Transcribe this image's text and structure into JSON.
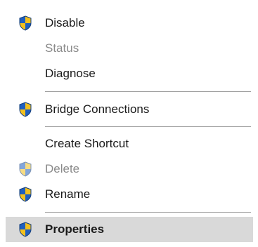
{
  "context_menu": {
    "items": [
      {
        "label": "Disable",
        "icon": "uac-shield-icon",
        "enabled": true
      },
      {
        "label": "Status",
        "icon": null,
        "enabled": false
      },
      {
        "label": "Diagnose",
        "icon": null,
        "enabled": true
      },
      {
        "label": "Bridge Connections",
        "icon": "uac-shield-icon",
        "enabled": true
      },
      {
        "label": "Create Shortcut",
        "icon": null,
        "enabled": true
      },
      {
        "label": "Delete",
        "icon": "uac-shield-icon",
        "enabled": false
      },
      {
        "label": "Rename",
        "icon": "uac-shield-icon",
        "enabled": true
      },
      {
        "label": "Properties",
        "icon": "uac-shield-icon",
        "enabled": true,
        "default": true,
        "highlighted": true
      }
    ]
  },
  "colors": {
    "shield_blue": "#1f5fbf",
    "shield_yellow": "#f2c01e",
    "disabled_text": "#8a8a8a",
    "highlight": "#d9d9d9",
    "separator": "#a0a0a0"
  }
}
